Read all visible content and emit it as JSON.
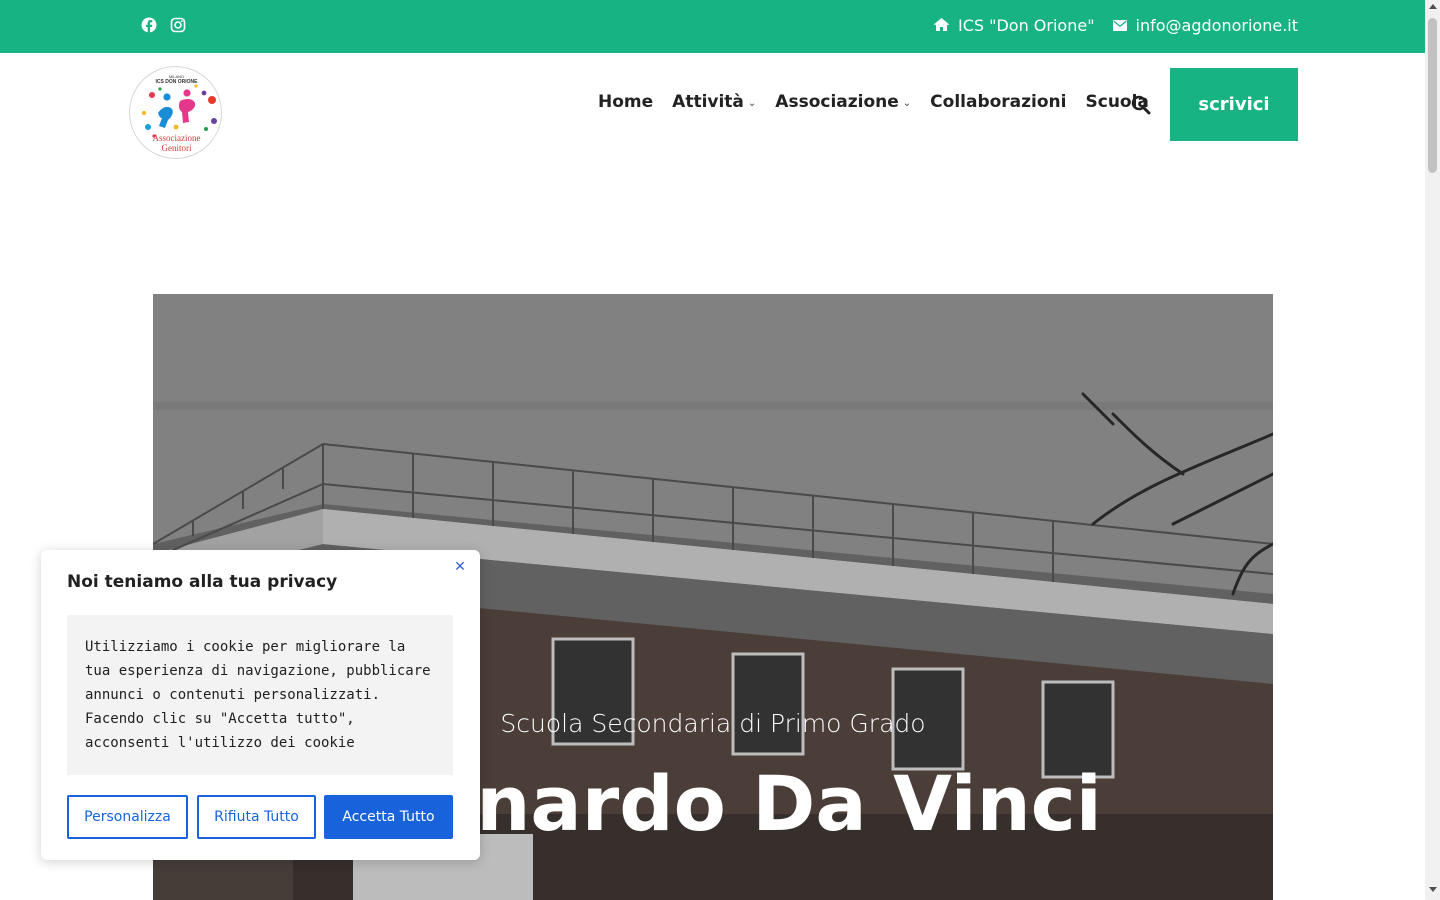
{
  "colors": {
    "brand_green": "#17b383",
    "cookie_blue": "#1863dc"
  },
  "topbar": {
    "social": [
      {
        "name": "facebook-icon"
      },
      {
        "name": "instagram-icon"
      }
    ],
    "school_label": "ICS \"Don Orione\"",
    "email_label": "info@agdonorione.it"
  },
  "header": {
    "logo": {
      "top_text_1": "MILANO",
      "top_text_2": "ICS DON ORIONE",
      "bottom_text_1": "Associazione",
      "bottom_text_2": "Genitori"
    },
    "nav": [
      {
        "label": "Home"
      },
      {
        "label": "Attività"
      },
      {
        "label": "Associazione"
      },
      {
        "label": "Collaborazioni"
      },
      {
        "label": "Scuola"
      }
    ],
    "cta_label": "scrivici"
  },
  "hero": {
    "subtitle": "Scuola Secondaria di Primo Grado",
    "title": "Leonardo Da Vinci"
  },
  "cookie": {
    "title": "Noi teniamo alla tua privacy",
    "body": "Utilizziamo i cookie per migliorare la tua esperienza di navigazione, pubblicare annunci o contenuti personalizzati. Facendo clic su \"Accetta tutto\", acconsenti l'utilizzo dei cookie",
    "buttons": {
      "customize": "Personalizza",
      "reject": "Rifiuta Tutto",
      "accept": "Accetta Tutto"
    }
  }
}
